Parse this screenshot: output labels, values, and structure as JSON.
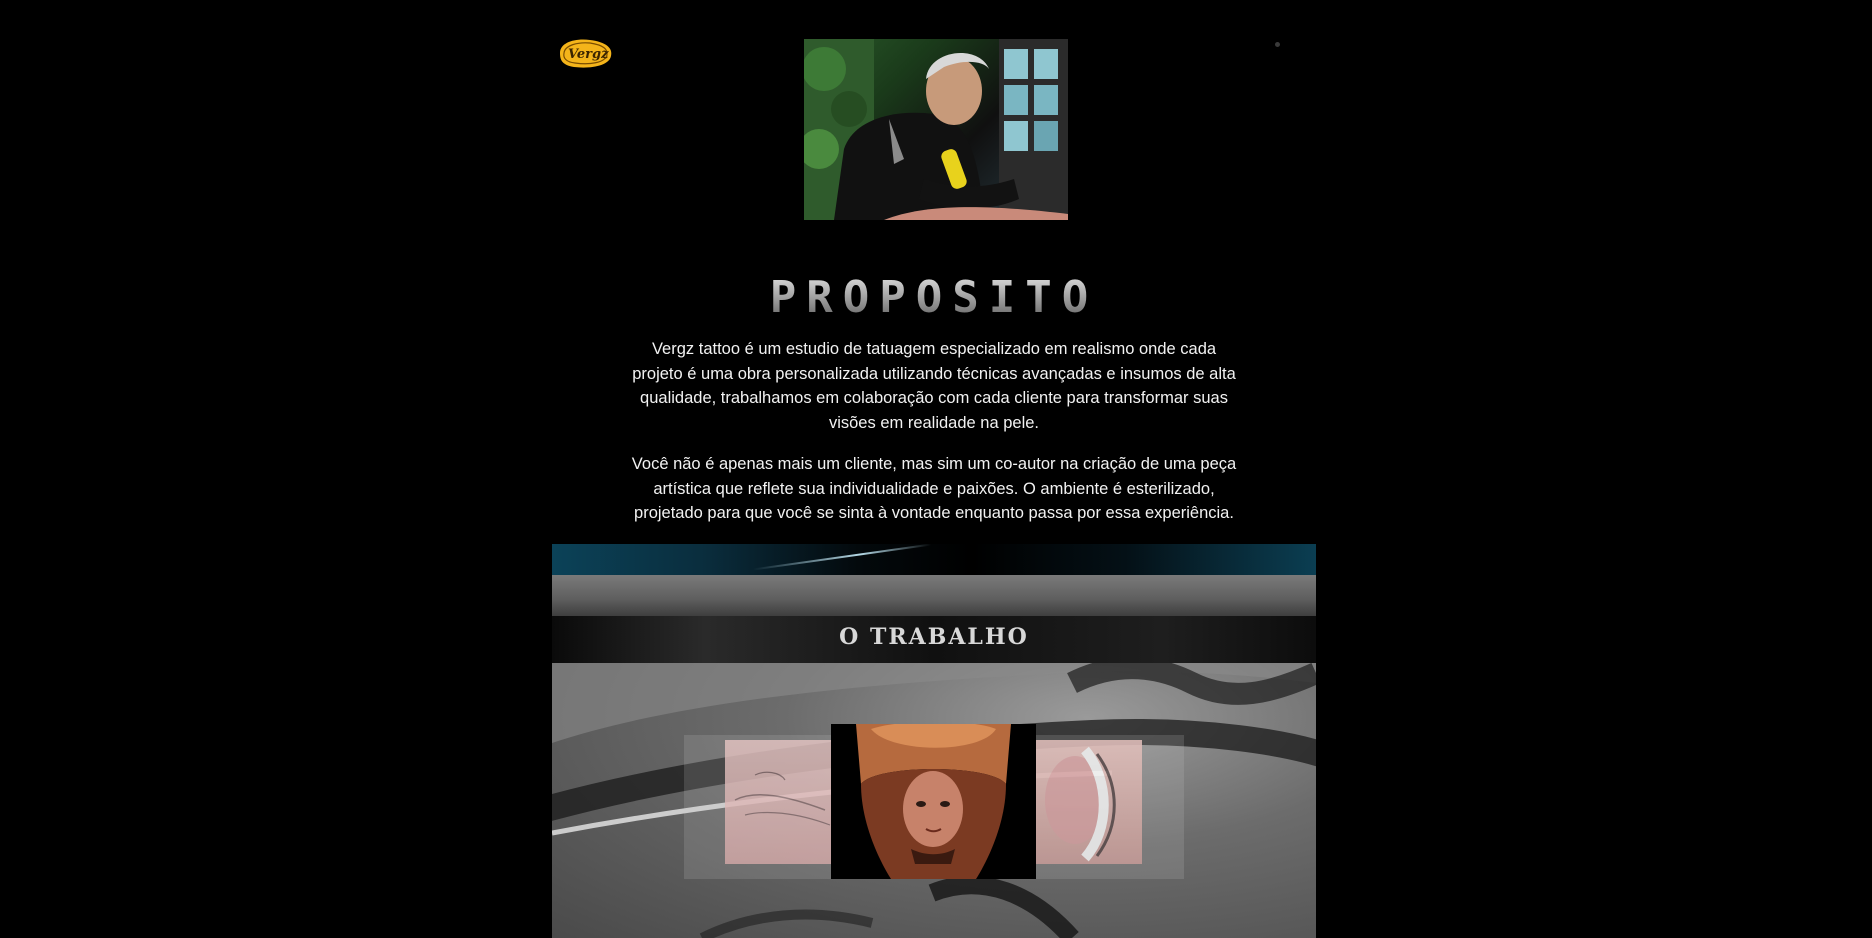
{
  "brand": {
    "logo_text": "Vergz",
    "logo_color": "#f4b41a"
  },
  "header": {
    "menu_icon": "menu-dot-icon",
    "hero_photo_alt": "tatuador trabalhando"
  },
  "proposito": {
    "title": "PROPOSITO",
    "paragraph_1": "Vergz tattoo é um estudio de tatuagem especializado em realismo onde cada projeto é uma obra personalizada utilizando técnicas avançadas e insumos de alta qualidade, trabalhamos em colaboração com cada cliente para transformar suas visões em realidade na pele.",
    "paragraph_2": "Você não é apenas mais um cliente, mas sim um co-autor na criação de uma peça artística que reflete sua individualidade e paixões. O ambiente é esterilizado, projetado para que você se sinta à vontade enquanto passa por essa experiência."
  },
  "trabalho": {
    "title": "O TRABALHO",
    "gallery": [
      {
        "position": "left",
        "description": "tattoo linework"
      },
      {
        "position": "center",
        "description": "woman with tiger headdress tattoo"
      },
      {
        "position": "right",
        "description": "portrait tattoo"
      }
    ]
  },
  "colors": {
    "background": "#000000",
    "text": "#f2f2f2",
    "accent_teal": "#0b4258"
  }
}
